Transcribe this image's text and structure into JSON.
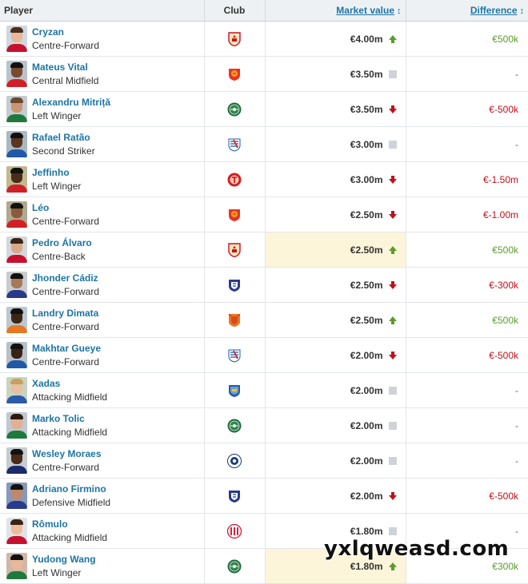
{
  "header": {
    "player": "Player",
    "club": "Club",
    "market_value": "Market value",
    "difference": "Difference",
    "sort_icon": "sort-arrows-icon"
  },
  "colors": {
    "link": "#1d75a3",
    "up": "#5c9c2a",
    "down": "#c0101a",
    "highlight": "#fcf5d9"
  },
  "rows": [
    {
      "name": "Cryzan",
      "position": "Centre-Forward",
      "club_icon": "club-crest-red-shield",
      "value": "€4.00m",
      "trend": "up",
      "diff": "€500k",
      "diff_type": "pos",
      "highlight": false
    },
    {
      "name": "Mateus Vital",
      "position": "Central Midfield",
      "club_icon": "club-crest-red-orange",
      "value": "€3.50m",
      "trend": "neutral",
      "diff": "-",
      "diff_type": "nil",
      "highlight": false
    },
    {
      "name": "Alexandru Mitriță",
      "position": "Left Winger",
      "club_icon": "club-crest-green-round",
      "value": "€3.50m",
      "trend": "down",
      "diff": "€-500k",
      "diff_type": "neg",
      "highlight": false
    },
    {
      "name": "Rafael Ratão",
      "position": "Second Striker",
      "club_icon": "club-crest-blue-shield",
      "value": "€3.00m",
      "trend": "neutral",
      "diff": "-",
      "diff_type": "nil",
      "highlight": false
    },
    {
      "name": "Jeffinho",
      "position": "Left Winger",
      "club_icon": "club-crest-red-round",
      "value": "€3.00m",
      "trend": "down",
      "diff": "€-1.50m",
      "diff_type": "neg",
      "highlight": false
    },
    {
      "name": "Léo",
      "position": "Centre-Forward",
      "club_icon": "club-crest-red-orange",
      "value": "€2.50m",
      "trend": "down",
      "diff": "€-1.00m",
      "diff_type": "neg",
      "highlight": false
    },
    {
      "name": "Pedro Álvaro",
      "position": "Centre-Back",
      "club_icon": "club-crest-red-shield",
      "value": "€2.50m",
      "trend": "up",
      "diff": "€500k",
      "diff_type": "pos",
      "highlight": true
    },
    {
      "name": "Jhonder Cádiz",
      "position": "Centre-Forward",
      "club_icon": "club-crest-navy-shield",
      "value": "€2.50m",
      "trend": "down",
      "diff": "€-300k",
      "diff_type": "neg",
      "highlight": false
    },
    {
      "name": "Landry Dimata",
      "position": "Centre-Forward",
      "club_icon": "club-crest-orange-shield",
      "value": "€2.50m",
      "trend": "up",
      "diff": "€500k",
      "diff_type": "pos",
      "highlight": false
    },
    {
      "name": "Makhtar Gueye",
      "position": "Centre-Forward",
      "club_icon": "club-crest-blue-shield",
      "value": "€2.00m",
      "trend": "down",
      "diff": "€-500k",
      "diff_type": "neg",
      "highlight": false
    },
    {
      "name": "Xadas",
      "position": "Attacking Midfield",
      "club_icon": "club-crest-blue-yellow",
      "value": "€2.00m",
      "trend": "neutral",
      "diff": "-",
      "diff_type": "nil",
      "highlight": false
    },
    {
      "name": "Marko Tolic",
      "position": "Attacking Midfield",
      "club_icon": "club-crest-green-round",
      "value": "€2.00m",
      "trend": "neutral",
      "diff": "-",
      "diff_type": "nil",
      "highlight": false
    },
    {
      "name": "Wesley Moraes",
      "position": "Centre-Forward",
      "club_icon": "club-crest-navy-round",
      "value": "€2.00m",
      "trend": "neutral",
      "diff": "-",
      "diff_type": "nil",
      "highlight": false
    },
    {
      "name": "Adriano Firmino",
      "position": "Defensive Midfield",
      "club_icon": "club-crest-navy-shield",
      "value": "€2.00m",
      "trend": "down",
      "diff": "€-500k",
      "diff_type": "neg",
      "highlight": false
    },
    {
      "name": "Rômulo",
      "position": "Attacking Midfield",
      "club_icon": "club-crest-red-white",
      "value": "€1.80m",
      "trend": "neutral",
      "diff": "-",
      "diff_type": "nil",
      "highlight": false
    },
    {
      "name": "Yudong Wang",
      "position": "Left Winger",
      "club_icon": "club-crest-green-round",
      "value": "€1.80m",
      "trend": "up",
      "diff": "€300k",
      "diff_type": "pos",
      "highlight": true
    }
  ],
  "watermark": "yxlqweasd.com"
}
